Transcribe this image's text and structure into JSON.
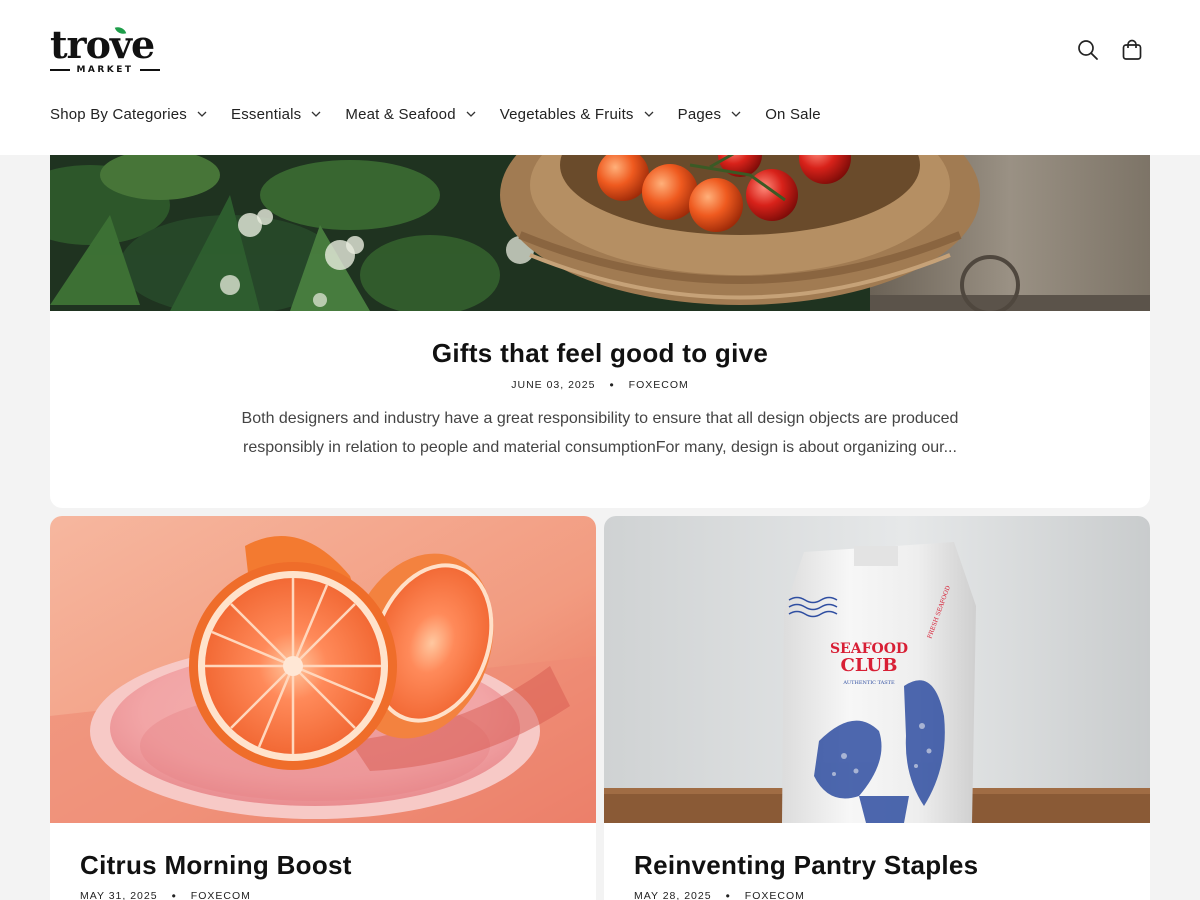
{
  "brand": {
    "name": "trove",
    "tagline": "MARKET",
    "accent_color": "#1e9e4a"
  },
  "header": {
    "icons": [
      "search-icon",
      "cart-icon"
    ],
    "nav": [
      {
        "label": "Shop By Categories",
        "has_dropdown": true
      },
      {
        "label": "Essentials",
        "has_dropdown": true
      },
      {
        "label": "Meat & Seafood",
        "has_dropdown": true
      },
      {
        "label": "Vegetables & Fruits",
        "has_dropdown": true
      },
      {
        "label": "Pages",
        "has_dropdown": true
      },
      {
        "label": "On Sale",
        "has_dropdown": false
      }
    ]
  },
  "featured": {
    "title": "Gifts that feel good to give",
    "date": "JUNE 03, 2025",
    "author": "FOXECOM",
    "separator": "•",
    "excerpt": "Both designers and industry have a great responsibility to ensure that all design objects are produced responsibly in relation to people and material consumptionFor many, design is about organizing our..."
  },
  "articles": [
    {
      "title": "Citrus Morning Boost",
      "date": "MAY 31, 2025",
      "author": "FOXECOM",
      "separator": "•"
    },
    {
      "title": "Reinventing Pantry Staples",
      "date": "MAY 28, 2025",
      "author": "FOXECOM",
      "separator": "•",
      "image_text": {
        "line1": "SEAFOOD",
        "line2": "CLUB",
        "small": "AUTHENTIC TASTE",
        "ring": "FRESH SEAFOOD"
      }
    }
  ]
}
